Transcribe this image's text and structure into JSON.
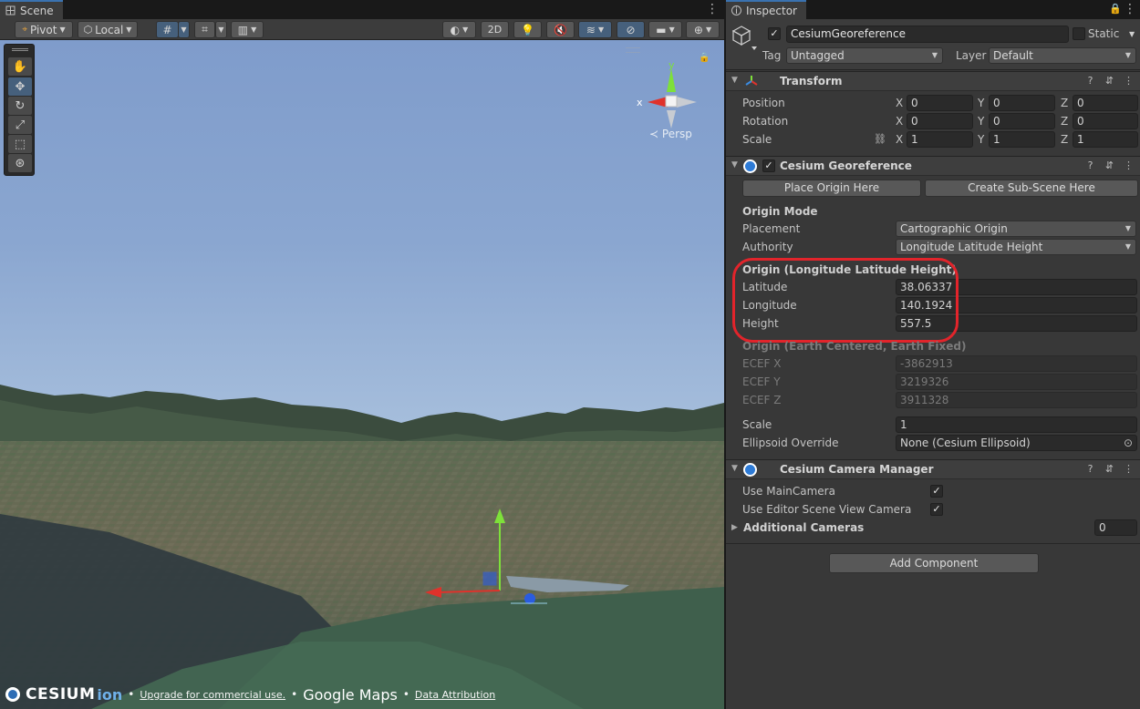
{
  "scene": {
    "tab_label": "Scene",
    "toolbar": {
      "pivot_label": "Pivot",
      "local_label": "Local",
      "mode_2d_label": "2D"
    },
    "gizmo": {
      "axis_x": "x",
      "axis_y": "y",
      "projection_label": "Persp"
    },
    "attribution": {
      "cesium_logo": "CESIUM",
      "ion_logo": "ion",
      "upgrade_link": "Upgrade for commercial use.",
      "google_maps_logo": "Google Maps",
      "data_attribution_link": "Data Attribution",
      "separator": "•"
    }
  },
  "inspector": {
    "tab_label": "Inspector",
    "game_object": {
      "enabled": true,
      "name": "CesiumGeoreference",
      "static_label": "Static",
      "tag_label": "Tag",
      "tag_value": "Untagged",
      "layer_label": "Layer",
      "layer_value": "Default"
    },
    "transform": {
      "title": "Transform",
      "rows": [
        {
          "label": "Position",
          "x": "0",
          "y": "0",
          "z": "0"
        },
        {
          "label": "Rotation",
          "x": "0",
          "y": "0",
          "z": "0"
        },
        {
          "label": "Scale",
          "x": "1",
          "y": "1",
          "z": "1"
        }
      ],
      "axis_x": "X",
      "axis_y": "Y",
      "axis_z": "Z"
    },
    "georeference": {
      "title": "Cesium Georeference",
      "enabled": true,
      "place_origin_button": "Place Origin Here",
      "create_subscene_button": "Create Sub-Scene Here",
      "origin_mode_heading": "Origin Mode",
      "placement_label": "Placement",
      "placement_value": "Cartographic Origin",
      "authority_label": "Authority",
      "authority_value": "Longitude Latitude Height",
      "llh_heading": "Origin (Longitude Latitude Height)",
      "latitude_label": "Latitude",
      "latitude_value": "38.06337",
      "longitude_label": "Longitude",
      "longitude_value": "140.1924",
      "height_label": "Height",
      "height_value": "557.5",
      "ecef_heading": "Origin (Earth Centered, Earth Fixed)",
      "ecef_x_label": "ECEF X",
      "ecef_x_value": "-3862913",
      "ecef_y_label": "ECEF Y",
      "ecef_y_value": "3219326",
      "ecef_z_label": "ECEF Z",
      "ecef_z_value": "3911328",
      "scale_label": "Scale",
      "scale_value": "1",
      "ellipsoid_label": "Ellipsoid Override",
      "ellipsoid_value": "None (Cesium Ellipsoid)"
    },
    "camera_manager": {
      "title": "Cesium Camera Manager",
      "use_main_camera_label": "Use MainCamera",
      "use_main_camera_checked": true,
      "use_editor_camera_label": "Use Editor Scene View Camera",
      "use_editor_camera_checked": true,
      "additional_cameras_label": "Additional Cameras",
      "additional_cameras_value": "0"
    },
    "add_component_button": "Add Component"
  },
  "colors": {
    "highlight": "#e2242b",
    "accent": "#46607c",
    "gizmo_x": "#e0322b",
    "gizmo_y": "#7ee03a",
    "gizmo_z": "#2a5ce0"
  }
}
